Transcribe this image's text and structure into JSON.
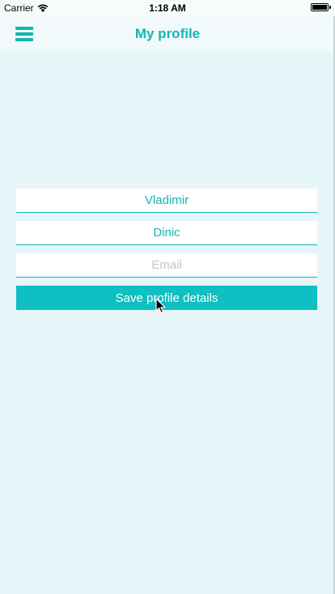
{
  "status_bar": {
    "carrier": "Carrier",
    "time": "1:18 AM",
    "wifi_icon": "wifi-icon",
    "battery_level": 1.0
  },
  "nav": {
    "menu_icon": "hamburger-menu-icon",
    "title": "My profile"
  },
  "form": {
    "first_name_value": "Vladimir",
    "last_name_value": "Dinic",
    "email_value": "",
    "email_placeholder": "Email",
    "save_label": "Save profile details"
  },
  "colors": {
    "accent": "#13b5b7",
    "button": "#0fbfc1",
    "background": "#e6f5f8",
    "placeholder": "#c4c4c4"
  }
}
